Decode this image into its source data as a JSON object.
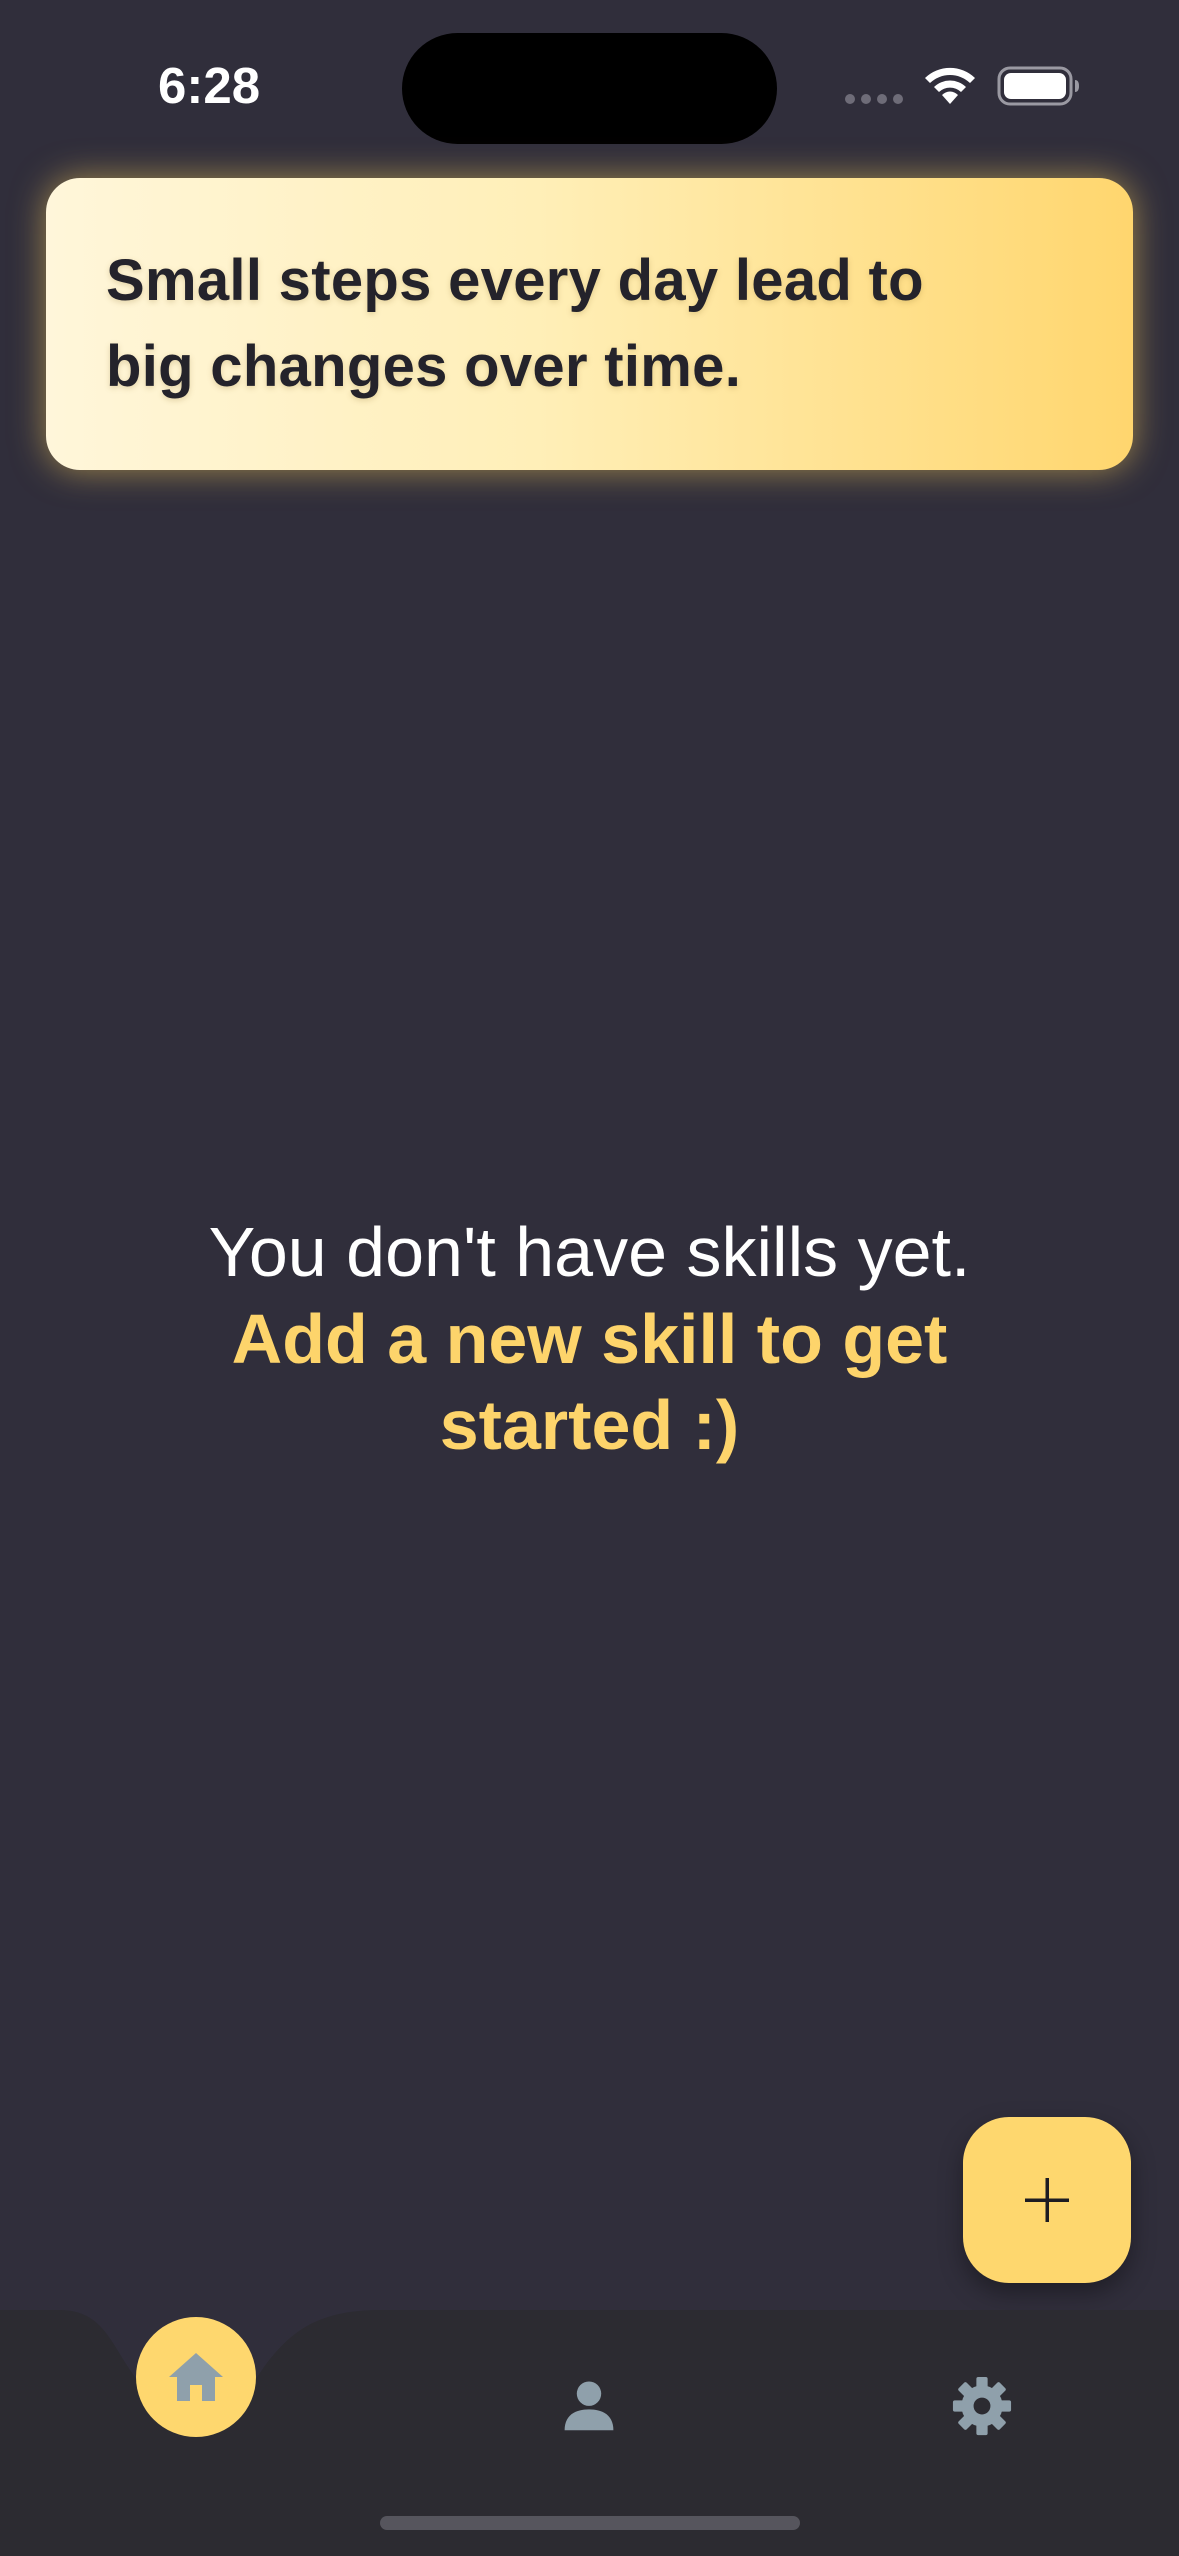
{
  "status_bar": {
    "time": "6:28"
  },
  "quote": {
    "line1": "Small steps every day lead to",
    "line2": "big changes over time."
  },
  "empty_state": {
    "message": "You don't have skills yet.",
    "call_to_action": "Add a new skill to get started :)"
  },
  "fab": {
    "icon": "plus-icon"
  },
  "nav": {
    "items": [
      {
        "icon": "home-icon",
        "active": true
      },
      {
        "icon": "person-icon",
        "active": false
      },
      {
        "icon": "gear-icon",
        "active": false
      }
    ]
  },
  "colors": {
    "background": "#302e3b",
    "accent": "#fed76e",
    "nav_background": "#2c2b31",
    "inactive_icon": "#8fa0ab"
  }
}
